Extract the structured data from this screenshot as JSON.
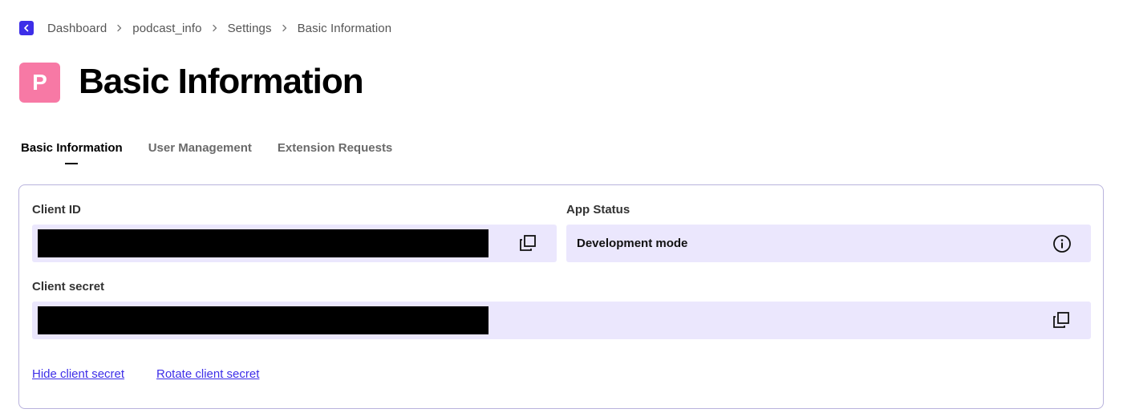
{
  "breadcrumb": {
    "items": [
      "Dashboard",
      "podcast_info",
      "Settings",
      "Basic Information"
    ]
  },
  "header": {
    "avatar_letter": "P",
    "title": "Basic Information"
  },
  "tabs": [
    {
      "label": "Basic Information",
      "active": true
    },
    {
      "label": "User Management",
      "active": false
    },
    {
      "label": "Extension Requests",
      "active": false
    }
  ],
  "card": {
    "client_id": {
      "label": "Client ID"
    },
    "app_status": {
      "label": "App Status",
      "value": "Development mode"
    },
    "client_secret": {
      "label": "Client secret"
    },
    "links": {
      "hide_secret": "Hide client secret",
      "rotate_secret": "Rotate client secret"
    }
  },
  "icons": {
    "back": "chevron-left-icon",
    "separator": "chevron-right-icon",
    "copy": "copy-icon",
    "info": "info-icon"
  },
  "colors": {
    "accent": "#3d2ee8",
    "avatar": "#f779a5",
    "field_bg": "#ebe7fd",
    "card_border": "#b9b3dd"
  }
}
